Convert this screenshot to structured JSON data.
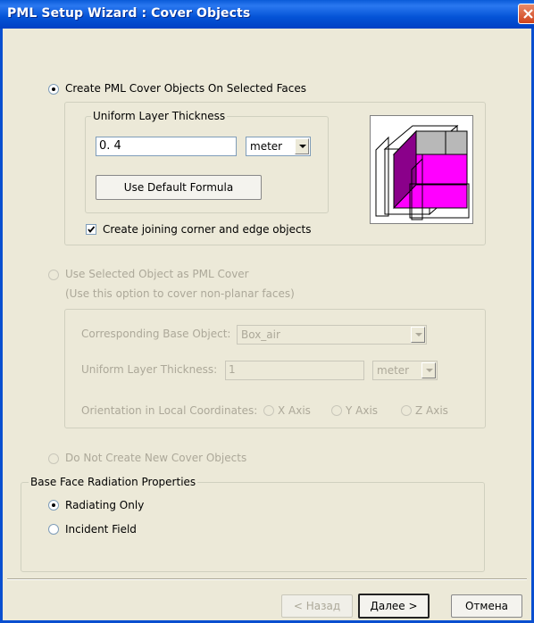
{
  "window": {
    "title": "PML Setup Wizard : Cover Objects"
  },
  "option_create": {
    "label": "Create PML Cover Objects On Selected Faces",
    "selected": true,
    "thickness_group_label": "Uniform Layer Thickness",
    "thickness_value": "0. 4",
    "units": "meter",
    "default_formula_label": "Use Default Formula",
    "joining_checkbox_label": "Create joining corner and edge objects",
    "joining_checked": true
  },
  "option_selected_object": {
    "label": "Use Selected Object as PML Cover",
    "hint": "(Use this option to cover non-planar faces)",
    "base_object_label": "Corresponding Base Object:",
    "base_object_value": "Box_air",
    "thickness_label": "Uniform Layer Thickness:",
    "thickness_value": "1",
    "units": "meter",
    "orientation_label": "Orientation in Local Coordinates:",
    "axes": [
      "X Axis",
      "Y Axis",
      "Z Axis"
    ]
  },
  "option_none": {
    "label": "Do Not Create New Cover Objects"
  },
  "radiation": {
    "group_label": "Base Face Radiation Properties",
    "options": [
      "Radiating Only",
      "Incident Field"
    ],
    "selected": "Radiating Only"
  },
  "buttons": {
    "back": "< Назад",
    "next": "Далее >",
    "cancel": "Отмена"
  },
  "colors": {
    "title_bar": "#0453d6",
    "face_magenta": "#ff00ff",
    "face_gray": "#b8b8b8"
  }
}
